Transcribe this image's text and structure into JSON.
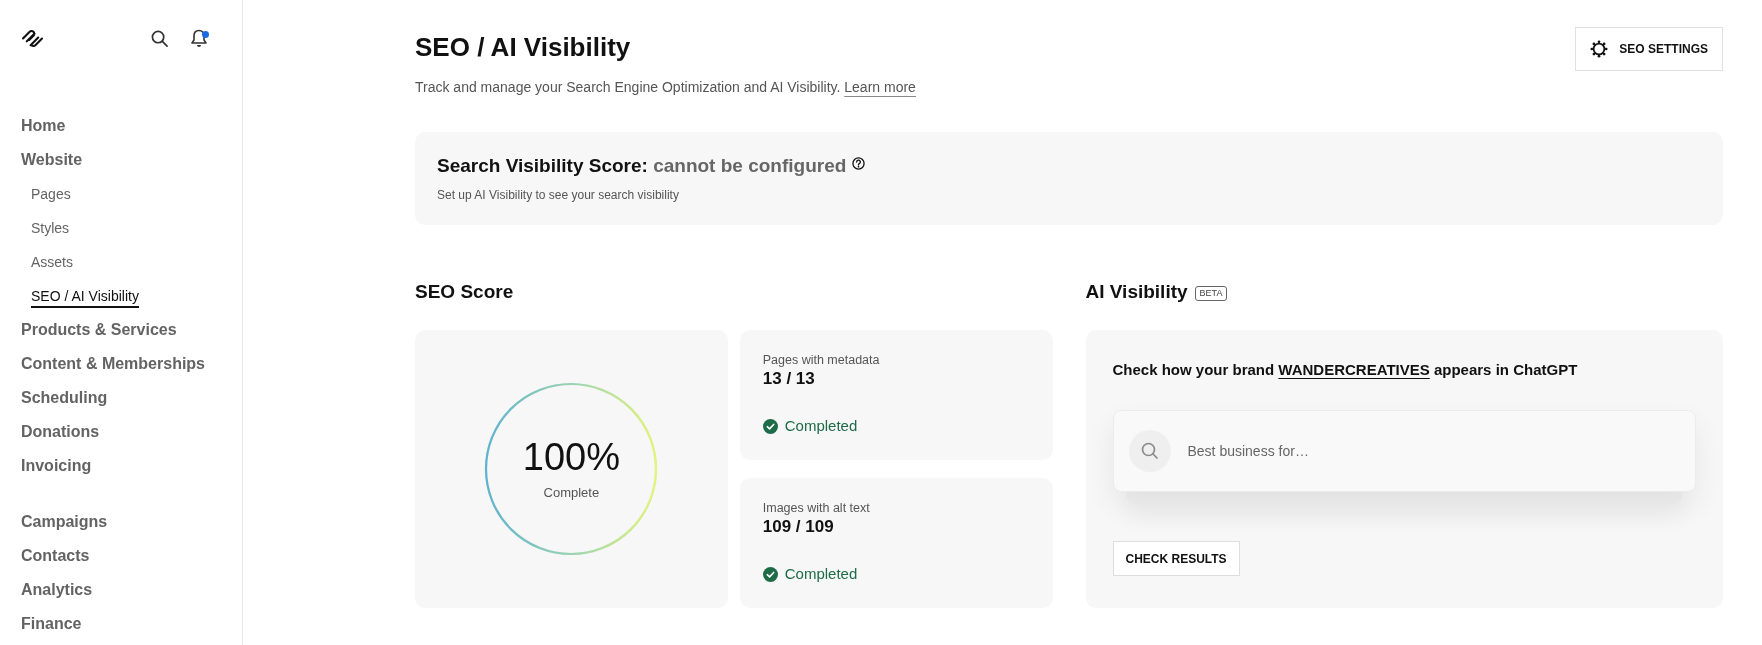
{
  "sidebar": {
    "notifications_unread": true,
    "nav_sections": [
      {
        "items": [
          {
            "label": "Home",
            "selected": false
          },
          {
            "label": "Website",
            "selected": false,
            "children": [
              {
                "label": "Pages",
                "selected": false
              },
              {
                "label": "Styles",
                "selected": false
              },
              {
                "label": "Assets",
                "selected": false
              },
              {
                "label": "SEO / AI Visibility",
                "selected": true
              }
            ]
          },
          {
            "label": "Products & Services",
            "selected": false
          },
          {
            "label": "Content & Memberships",
            "selected": false
          },
          {
            "label": "Scheduling",
            "selected": false
          },
          {
            "label": "Donations",
            "selected": false
          },
          {
            "label": "Invoicing",
            "selected": false
          }
        ]
      },
      {
        "items": [
          {
            "label": "Campaigns",
            "selected": false
          },
          {
            "label": "Contacts",
            "selected": false
          },
          {
            "label": "Analytics",
            "selected": false
          },
          {
            "label": "Finance",
            "selected": false
          }
        ]
      }
    ]
  },
  "header": {
    "title": "SEO / AI Visibility",
    "description": "Track and manage your Search Engine Optimization and AI Visibility.",
    "learn_more_link": "Learn more",
    "settings_button": "SEO SETTINGS"
  },
  "search_visibility": {
    "title": "Search Visibility Score:",
    "status": "cannot be configured",
    "hint": "Set up AI Visibility to see your search visibility"
  },
  "seo_score": {
    "heading": "SEO Score",
    "overall": {
      "value": "100%",
      "caption": "Complete",
      "level": 1
    },
    "metrics": [
      {
        "label": "Pages with metadata",
        "value": "13 / 13",
        "status": "Completed",
        "complete": true
      },
      {
        "label": "Images with alt text",
        "value": "109 / 109",
        "status": "Completed",
        "complete": true
      }
    ]
  },
  "ai_visibility": {
    "heading": "AI Visibility",
    "badge": "BETA",
    "prompt": {
      "text_before": "Check how your brand",
      "brand": "WANDERCREATIVES",
      "text_after": "appears in ChatGPT"
    },
    "search_field": {
      "placeholder": "Best business for…"
    },
    "check_button": "CHECK RESULTS"
  }
}
